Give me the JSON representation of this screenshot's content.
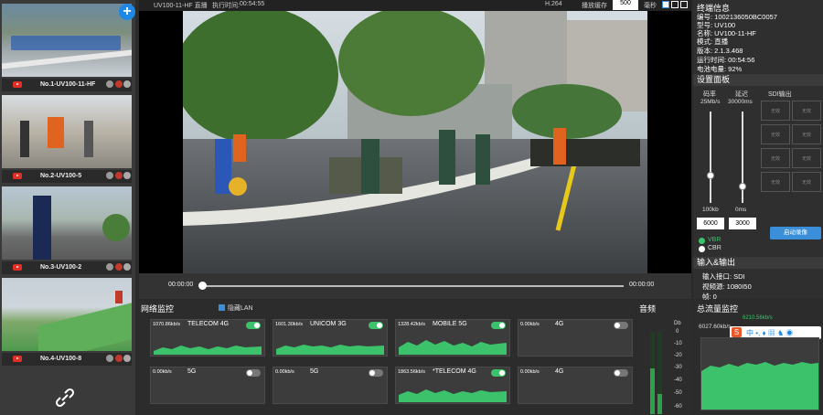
{
  "sidebar": {
    "thumbs": [
      {
        "name": "No.1-UV100-11-HF"
      },
      {
        "name": "No.2-UV100-5"
      },
      {
        "name": "No.3-UV100-2"
      },
      {
        "name": "No.4-UV100-8"
      }
    ],
    "add_label": "+"
  },
  "topbar": {
    "title": "UV100-11-HF 直播",
    "exec_label": "执行时间:",
    "exec_time": "00:54:55",
    "codec": "H.264",
    "buffer_label": "播放缓存",
    "buffer_value": "500",
    "ms_label": "毫秒"
  },
  "controls": {
    "time_left": "00:00:00",
    "time_right": "00:00:00"
  },
  "terminal": {
    "title": "终端信息",
    "lines": [
      "编号: 1002136050BC0057",
      "型号: UV100",
      "名称: UV100-11-HF",
      "模式: 直播",
      "版本: 2.1.3.468",
      "运行时间: 00:54:56",
      "电池电量: 92%"
    ]
  },
  "settings": {
    "title": "设置面板",
    "bitrate_label": "码率",
    "bitrate_top": "25Mb/s",
    "delay_label": "延迟",
    "delay_top": "30000ms",
    "sdi_label": "SDI输出",
    "bitrate_min": "100kb",
    "delay_min": "0ms",
    "bitrate_value": "6000",
    "delay_value": "3000",
    "vbr": "VBR",
    "cbr": "CBR",
    "record_btn": "启动录像",
    "sdi_cell": "无效"
  },
  "io": {
    "title": "输入&输出",
    "lines": [
      "输入接口: SDI",
      "视频源: 1080I50",
      "帧: 0"
    ]
  },
  "net": {
    "title": "网络监控",
    "hide_lan": "隐藏LAN",
    "boxes": [
      {
        "rate": "1070.86kb/s",
        "name": "TELECOM 4G",
        "on": true
      },
      {
        "rate": "1601.30kb/s",
        "name": "UNICOM 3G",
        "on": true
      },
      {
        "rate": "1328.42kb/s",
        "name": "MOBILE 5G",
        "on": true
      },
      {
        "rate": "0.00kb/s",
        "name": "4G",
        "on": false
      },
      {
        "rate": "0.00kb/s",
        "name": "5G",
        "on": false
      },
      {
        "rate": "0.00kb/s",
        "name": "5G",
        "on": false
      },
      {
        "rate": "1863.56kb/s",
        "name": "*TELECOM 4G",
        "on": true
      },
      {
        "rate": "0.00kb/s",
        "name": "4G",
        "on": false
      }
    ]
  },
  "audio": {
    "title": "音频",
    "db_label": "Db",
    "ticks": [
      "0",
      "-10",
      "-20",
      "-30",
      "-40",
      "-50",
      "-60"
    ]
  },
  "total": {
    "title": "总流量监控",
    "value": "6027.60kb/s",
    "value2": "6210.56kb/s"
  },
  "colors": {
    "accent": "#3cc26a",
    "blue": "#1e88e5"
  }
}
